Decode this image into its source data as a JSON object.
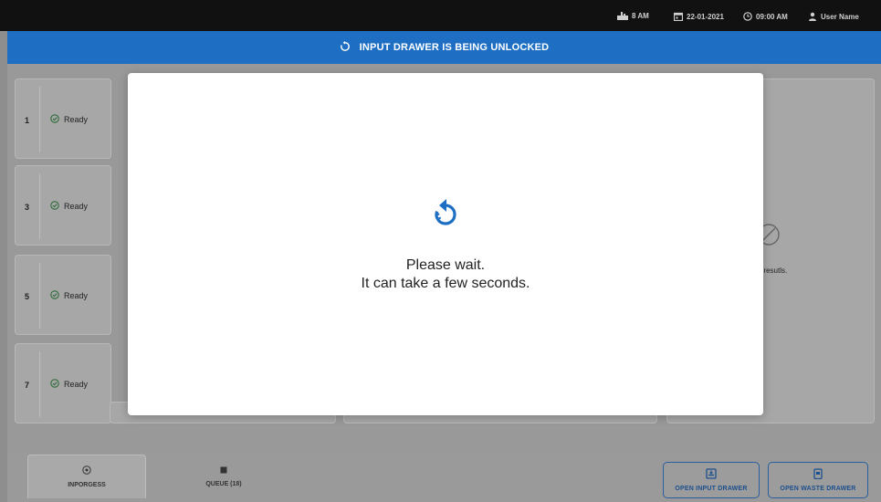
{
  "status_bar": {
    "temperature": "8 AM",
    "date": "22-01-2021",
    "time": "09:00 AM",
    "user": "User Name"
  },
  "banner": {
    "text": "INPUT DRAWER IS BEING UNLOCKED"
  },
  "slots": [
    {
      "number": "1",
      "status": "Ready"
    },
    {
      "number": "3",
      "status": "Ready"
    },
    {
      "number": "5",
      "status": "Ready"
    },
    {
      "number": "7",
      "status": "Ready"
    }
  ],
  "background_panel": {
    "text": "st resutls."
  },
  "modal": {
    "line1": "Please wait.",
    "line2": "It can take a few seconds."
  },
  "tabs": [
    {
      "label": "INPORGESS",
      "icon": "target-icon"
    },
    {
      "label": "QUEUE (18)",
      "icon": "square-icon"
    }
  ],
  "actions": {
    "open_input_drawer": "OPEN INPUT DRAWER",
    "open_waste_drawer": "OPEN WASTE DRAWER"
  },
  "colors": {
    "banner": "#1e6fc4",
    "accent": "#1e6fc4",
    "ready_green": "#2e6b3a"
  }
}
